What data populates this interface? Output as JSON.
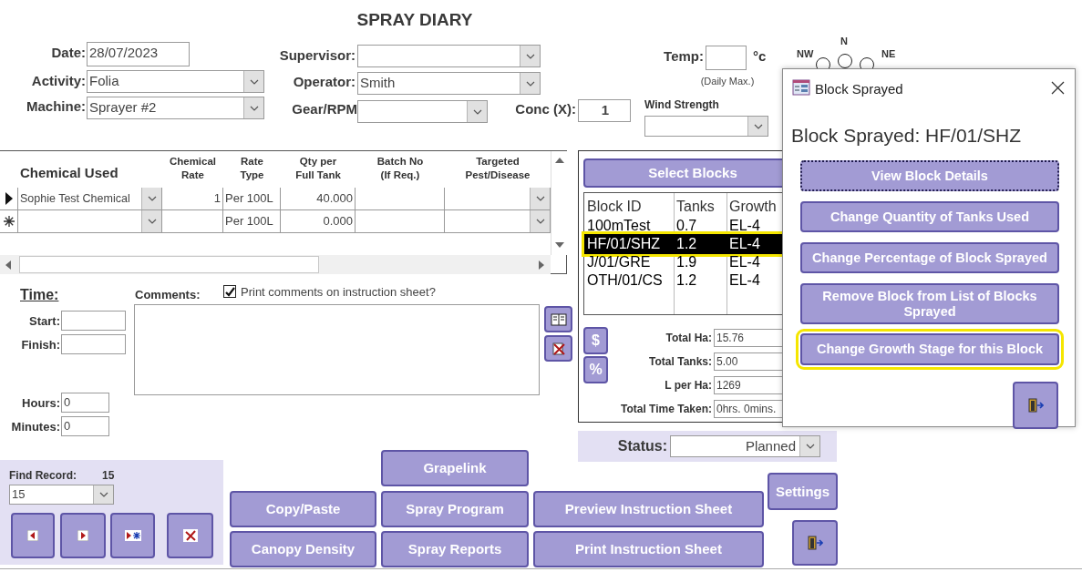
{
  "title": "SPRAY DIARY",
  "header_fields": [
    {
      "label": "Date:",
      "value": "28/07/2023",
      "kind": "text"
    },
    {
      "label": "Activity:",
      "value": "Folia",
      "kind": "combo"
    },
    {
      "label": "Machine:",
      "value": "Sprayer #2",
      "kind": "combo"
    },
    {
      "label": "Supervisor:",
      "kind": "combo"
    },
    {
      "label": "Operator:",
      "value": "Smith",
      "kind": "combo"
    },
    {
      "label": "Gear/RPM",
      "kind": "combo"
    },
    {
      "label": "Conc (X):",
      "value": "1",
      "kind": "text"
    }
  ],
  "temperature": {
    "label": "Temp:",
    "unit": "°c",
    "note": "(Daily Max.)"
  },
  "wind": {
    "label": "Wind Strength",
    "directions": [
      {
        "label": "N",
        "selected": false
      },
      {
        "label": "NW",
        "selected": false
      },
      {
        "label": "NE",
        "selected": false
      }
    ]
  },
  "chemicals": {
    "columns": [
      "Chemical Used",
      "Chemical\nRate",
      "Rate\nType",
      "Qty per\nFull Tank",
      "Batch No\n(If Req.)",
      "Targeted\nPest/Disease"
    ],
    "rows": [
      {
        "kind": "current",
        "chemical": "Sophie Test Chemical",
        "rate": "1",
        "rate_type": "Per 100L",
        "qty": "40.000"
      },
      {
        "kind": "new",
        "rate_type": "Per 100L",
        "qty": "0.000"
      }
    ]
  },
  "time": {
    "title": "Time:",
    "fields": [
      {
        "label": "Start:"
      },
      {
        "label": "Finish:"
      },
      {
        "label": "Hours:",
        "value": "0"
      },
      {
        "label": "Minutes:",
        "value": "0"
      }
    ]
  },
  "comments": {
    "label": "Comments:",
    "print_option": {
      "label": "Print comments on instruction sheet?",
      "checked": true
    }
  },
  "blocks": {
    "select_button": "Select Blocks",
    "columns": [
      "Block ID",
      "Tanks",
      "Growth"
    ],
    "rows": [
      {
        "block_id": "100mTest",
        "tanks": "0.7",
        "growth": "EL-4",
        "selected": false
      },
      {
        "block_id": "HF/01/SHZ",
        "tanks": "1.2",
        "growth": "EL-4",
        "selected": true
      },
      {
        "block_id": "J/01/GRE",
        "tanks": "1.9",
        "growth": "EL-4",
        "selected": false
      },
      {
        "block_id": "OTH/01/CS",
        "tanks": "1.2",
        "growth": "EL-4",
        "selected": false
      }
    ],
    "side_buttons": [
      "$",
      "%"
    ],
    "totals": [
      {
        "label": "Total Ha:",
        "value": "15.76"
      },
      {
        "label": "Total Tanks:",
        "value": "5.00"
      },
      {
        "label": "L per Ha:",
        "value": "1269"
      },
      {
        "label": "Total Time Taken:",
        "value": "0hrs. 0mins."
      }
    ]
  },
  "status": {
    "label": "Status:",
    "value": "Planned"
  },
  "find_record": {
    "label": "Find Record:",
    "count": "15",
    "value": "15"
  },
  "buttons": [
    "Grapelink",
    "Copy/Paste",
    "Spray Program",
    "Preview Instruction Sheet",
    "Canopy Density",
    "Spray Reports",
    "Print Instruction Sheet",
    "Settings"
  ],
  "dialog": {
    "title": "Block Sprayed",
    "heading": "Block Sprayed: HF/01/SHZ",
    "buttons": [
      {
        "label": "View Block Details",
        "focused": true,
        "highlighted": false
      },
      {
        "label": "Change Quantity of Tanks Used",
        "focused": false,
        "highlighted": false
      },
      {
        "label": "Change Percentage of Block Sprayed",
        "focused": false,
        "highlighted": false
      },
      {
        "label": "Remove Block from List of Blocks Sprayed",
        "focused": false,
        "highlighted": false
      },
      {
        "label": "Change Growth Stage for this Block",
        "focused": false,
        "highlighted": true
      }
    ]
  }
}
